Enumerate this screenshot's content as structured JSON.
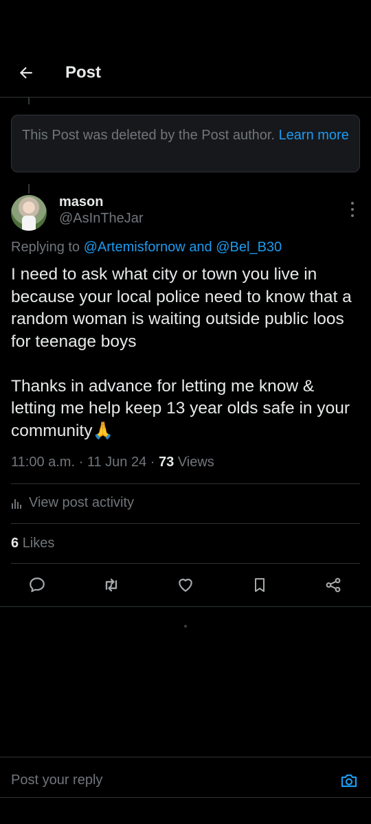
{
  "header": {
    "title": "Post"
  },
  "deleted_notice": {
    "text": "This Post was deleted by the Post author.",
    "link": "Learn more"
  },
  "post": {
    "author_name": "mason",
    "author_handle": "@AsInTheJar",
    "replying_prefix": "Replying to",
    "mention_1": "@Artemisfornow",
    "mention_joiner": "and",
    "mention_2": "@Bel_B30",
    "paragraph_1": "I need to ask what city or town you live in because your local police need to know that a random woman is waiting outside public loos for teenage boys",
    "paragraph_2": "Thanks in advance for letting me know & letting me help keep 13 year olds safe in your community🙏",
    "time": "11:00 a.m.",
    "date": "11 Jun 24",
    "views_count": "73",
    "views_label": "Views",
    "activity_label": "View post activity",
    "likes_count": "6",
    "likes_label": "Likes"
  },
  "actions": {
    "reply_icon": "comment-icon",
    "repost_icon": "repost-icon",
    "like_icon": "heart-icon",
    "bookmark_icon": "bookmark-icon",
    "share_icon": "share-icon"
  },
  "reply_bar": {
    "placeholder": "Post your reply",
    "camera_icon": "camera-icon"
  },
  "colors": {
    "accent": "#1d9bf0",
    "muted": "#71767b",
    "text": "#e7e9ea",
    "background": "#000000"
  }
}
